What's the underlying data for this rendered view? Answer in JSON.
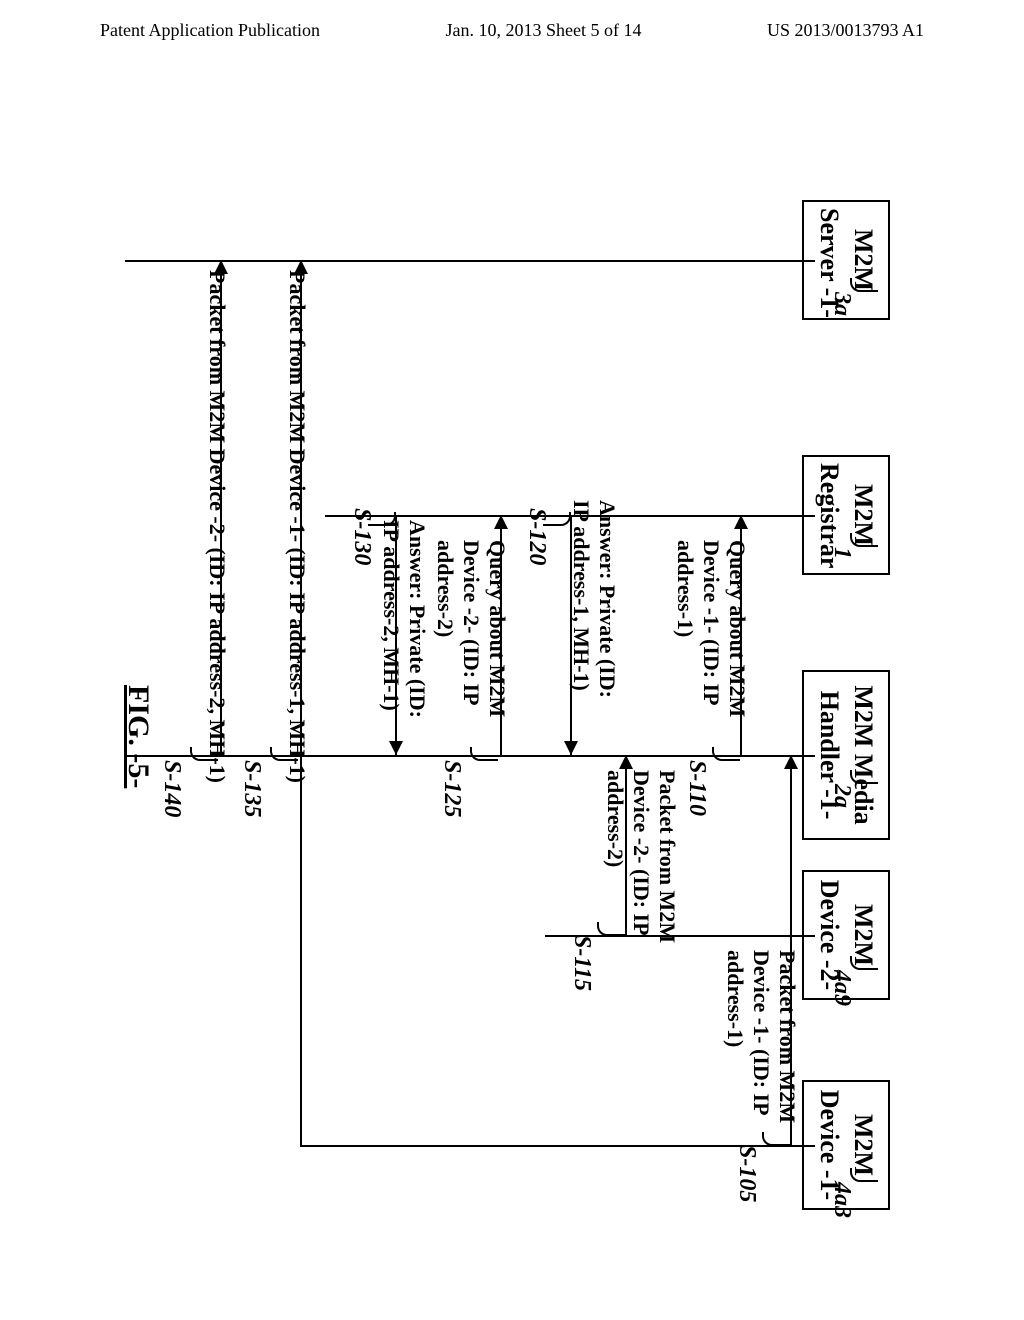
{
  "header": {
    "left": "Patent Application Publication",
    "center": "Jan. 10, 2013  Sheet 5 of 14",
    "right": "US 2013/0013793 A1"
  },
  "entities": {
    "device1": {
      "label": "M2M\nDevice -1-",
      "tag": "4a3"
    },
    "device2": {
      "label": "M2M\nDevice -2-",
      "tag": "4a9"
    },
    "handler": {
      "label": "M2M Media\nHandler -1-",
      "tag": "2a"
    },
    "registrar": {
      "label": "M2M\nRegistrar",
      "tag": "1"
    },
    "server": {
      "label": "M2M\nServer -1-",
      "tag": "3a"
    }
  },
  "messages": {
    "s105": {
      "text": "Packet from M2M\nDevice -1- (ID: IP\naddress-1)",
      "step": "S-105"
    },
    "s110": {
      "text": "Query about M2M\nDevice -1- (ID: IP\naddress-1)",
      "step": "S-110"
    },
    "s115": {
      "text": "Packet from M2M\nDevice -2- (ID: IP\naddress-2)",
      "step": "S-115"
    },
    "s120": {
      "text": "Answer: Private (ID:\nIP address-1, MH-1)",
      "step": "S-120"
    },
    "s125": {
      "text": "Query about M2M\nDevice -2- (ID: IP\naddress-2)",
      "step": "S-125"
    },
    "s130": {
      "text": "Answer: Private (ID:\nIP address-2, MH-1)",
      "step": "S-130"
    },
    "s135": {
      "text": "Packet from M2M Device -1- (ID: IP address-1, MH-1)",
      "step": "S-135"
    },
    "s140": {
      "text": "Packet from M2M Device -2- (ID: IP address-2, MH-1)",
      "step": "S-140"
    }
  },
  "figure": "FIG. -5-"
}
